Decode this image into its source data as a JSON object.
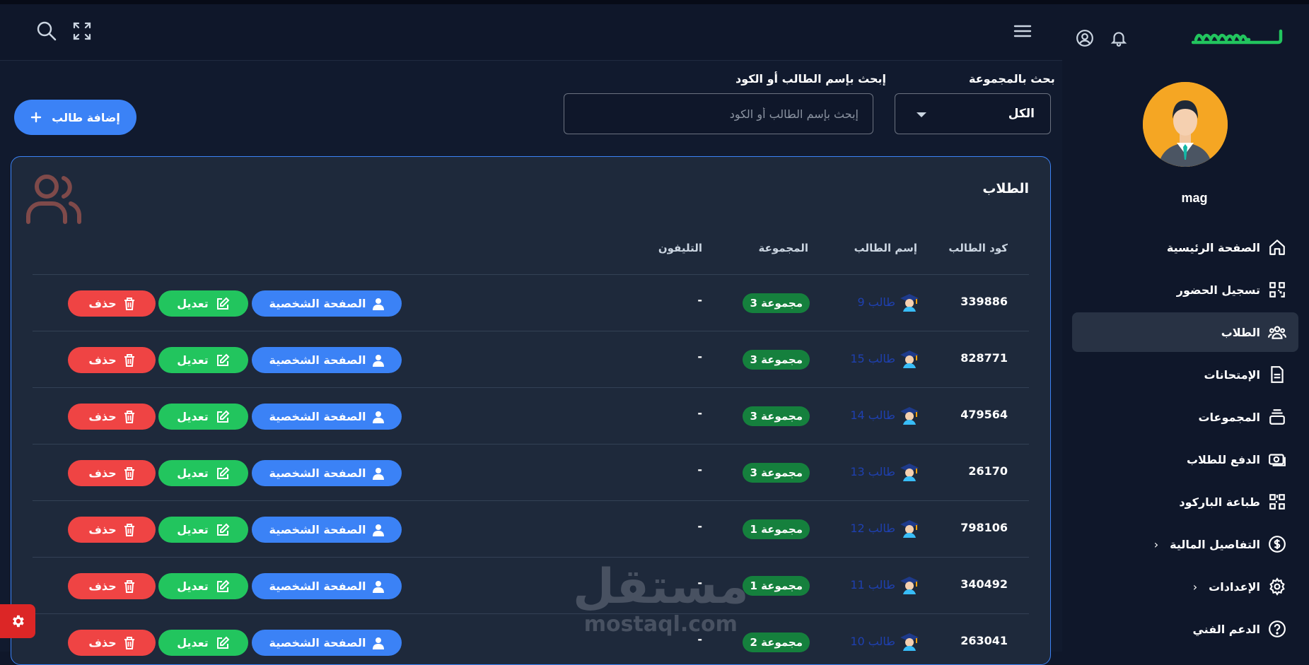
{
  "brand": {
    "logo_text": "سهلي",
    "accent": "#22c55e"
  },
  "user": {
    "name": "mag"
  },
  "sidebar": {
    "items": [
      {
        "label": "الصفحة الرئيسية",
        "icon": "home-icon"
      },
      {
        "label": "تسجيل الحضور",
        "icon": "qr-icon"
      },
      {
        "label": "الطلاب",
        "icon": "users-icon",
        "active": true
      },
      {
        "label": "الإمتحانات",
        "icon": "document-icon"
      },
      {
        "label": "المجموعات",
        "icon": "stack-icon"
      },
      {
        "label": "الدفع للطلاب",
        "icon": "cash-icon"
      },
      {
        "label": "طباعة الباركود",
        "icon": "barcode-icon"
      },
      {
        "label": "التفاصيل المالية",
        "icon": "dollar-icon",
        "expandable": true
      },
      {
        "label": "الإعدادات",
        "icon": "gear-icon",
        "expandable": true
      },
      {
        "label": "الدعم الفني",
        "icon": "help-icon"
      }
    ]
  },
  "filters": {
    "group_label": "بحث بالمجموعة",
    "group_value": "الكل",
    "search_label": "إبحث بإسم الطالب أو الكود",
    "search_placeholder": "إبحث بإسم الطالب أو الكود"
  },
  "add_button": {
    "label": "إضافة طالب"
  },
  "table": {
    "title": "الطلاب",
    "columns": {
      "code": "كود الطالب",
      "name": "إسم الطالب",
      "group": "المجموعة",
      "phone": "التليفون"
    },
    "actions": {
      "profile": "الصفحة الشخصية",
      "edit": "تعديل",
      "delete": "حذف"
    },
    "rows": [
      {
        "code": "339886",
        "name": "طالب 9",
        "group": "مجموعة 3",
        "phone": "-"
      },
      {
        "code": "828771",
        "name": "طالب 15",
        "group": "مجموعة 3",
        "phone": "-"
      },
      {
        "code": "479564",
        "name": "طالب 14",
        "group": "مجموعة 3",
        "phone": "-"
      },
      {
        "code": "26170",
        "name": "طالب 13",
        "group": "مجموعة 3",
        "phone": "-"
      },
      {
        "code": "798106",
        "name": "طالب 12",
        "group": "مجموعة 1",
        "phone": "-"
      },
      {
        "code": "340492",
        "name": "طالب 11",
        "group": "مجموعة 1",
        "phone": "-"
      },
      {
        "code": "263041",
        "name": "طالب 10",
        "group": "مجموعة 2",
        "phone": "-"
      }
    ]
  },
  "watermark": {
    "arabic": "مستقل",
    "latin": "mostaql.com"
  }
}
